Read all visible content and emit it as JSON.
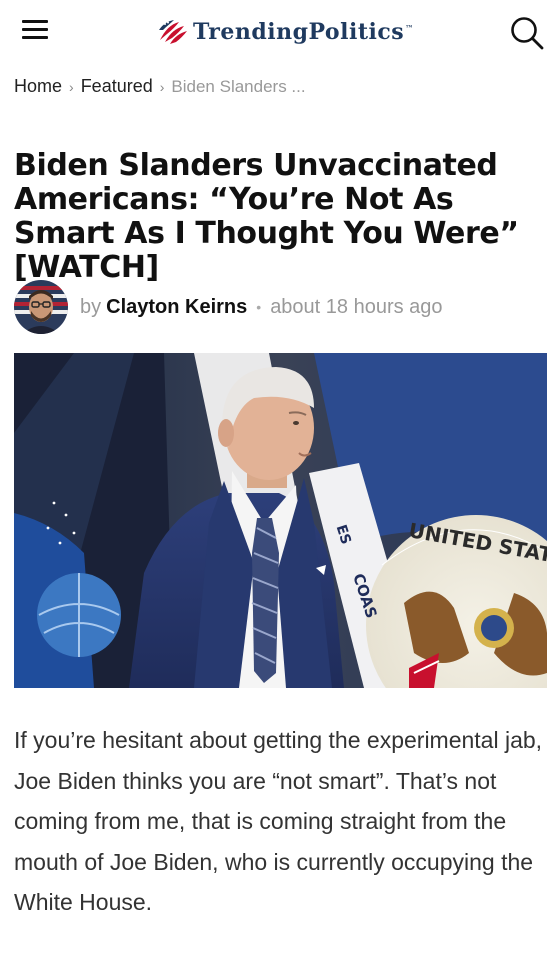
{
  "header": {
    "logo_text": "TrendingPolitics",
    "logo_tm": "™",
    "menu_icon": "hamburger-menu-icon",
    "search_icon": "search-icon"
  },
  "breadcrumb": {
    "items": [
      "Home",
      "Featured"
    ],
    "current": "Biden Slanders ...",
    "separator": "›"
  },
  "article": {
    "title": "Biden Slanders Unvaccinated Americans: “You’re Not As Smart As I Thought You Were” [WATCH]",
    "by_label": "by",
    "author": "Clayton Keirns",
    "meta_separator": "•",
    "time": "about 18 hours ago",
    "image_text": {
      "seal_text": "UNITED STATES OF AM",
      "flag_text_1": "COAS",
      "flag_text_2": "ES"
    },
    "body": "If you’re hesitant about getting the experimental jab, Joe Biden thinks you are “not smart”. That’s not coming from me, that is coming straight from the mouth of Joe Biden, who is currently occupying the White House."
  },
  "colors": {
    "logo_blue": "#1f3a5f",
    "logo_red": "#c8102e",
    "muted_text": "#999999"
  }
}
